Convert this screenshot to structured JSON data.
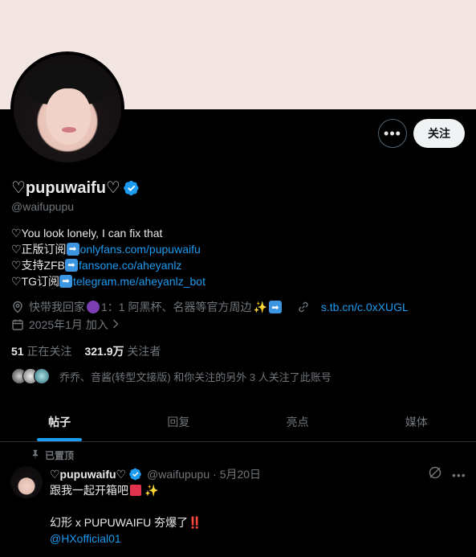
{
  "profile": {
    "name": "♡pupuwaifu♡",
    "handle": "@waifupupu",
    "follow_label": "关注",
    "more_label": "•••",
    "bio": {
      "line1": "♡You look lonely, I can fix that",
      "line2_prefix": "♡正版订阅",
      "line2_link": "onlyfans.com/pupuwaifu",
      "line3_prefix": "♡支持ZFB",
      "line3_link": "fansone.co/aheyanlz",
      "line4_prefix": "♡TG订阅",
      "line4_link": "telegram.me/aheyanlz_bot"
    },
    "location_prefix": "快带我回家",
    "location_suffix": "1：1 阿黑杯、名器等官方周边",
    "website": "s.tb.cn/c.0xXUGL",
    "joined": "2025年1月 加入",
    "following_count": "51",
    "following_label": "正在关注",
    "followers_count": "321.9万",
    "followers_label": "关注者",
    "mutuals_text": "乔乔、音酱(转型文接版) 和你关注的另外 3 人关注了此账号"
  },
  "tabs": [
    "帖子",
    "回复",
    "亮点",
    "媒体"
  ],
  "pinned_post": {
    "pinned_label": "已置顶",
    "author_name": "♡pupuwaifu♡",
    "author_handle": "@waifupupu",
    "date": "· 5月20日",
    "line1": "跟我一起开箱吧",
    "line2_prefix": "幻形 x PUPUWAIFU 夯爆了",
    "line2_suffix": "‼️",
    "mention": "@HXofficial01"
  },
  "colors": {
    "accent": "#1d9bf0",
    "banner": "#f3e6e2",
    "background": "#000000"
  },
  "icons": [
    "ellipsis-icon",
    "verified-badge-icon",
    "location-icon",
    "link-icon",
    "calendar-icon",
    "pin-icon",
    "grok-icon"
  ]
}
